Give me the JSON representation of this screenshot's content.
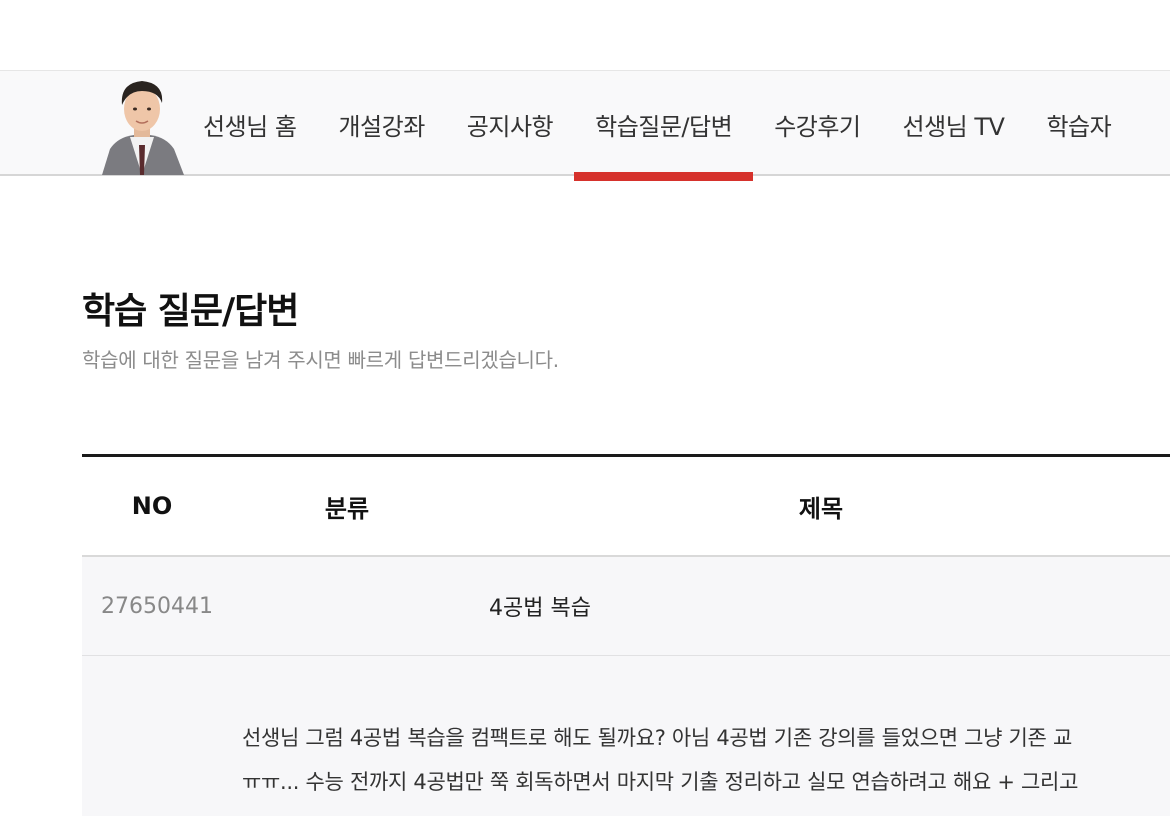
{
  "nav": {
    "tabs": [
      {
        "label": "선생님 홈"
      },
      {
        "label": "개설강좌"
      },
      {
        "label": "공지사항"
      },
      {
        "label": "학습질문/답변"
      },
      {
        "label": "수강후기"
      },
      {
        "label": "선생님 TV"
      },
      {
        "label": "학습자"
      }
    ],
    "active_tab": "학습질문/답변",
    "active_color": "#d6322c"
  },
  "page": {
    "title": "학습 질문/답변",
    "description": "학습에 대한 질문을 남겨 주시면 빠르게 답변드리겠습니다."
  },
  "table": {
    "headers": {
      "no": "NO",
      "category": "분류",
      "title": "제목"
    },
    "rows": [
      {
        "no": "27650441",
        "category": "",
        "title": "4공법 복습"
      }
    ]
  },
  "expanded": {
    "lines": [
      "선생님 그럼 4공법 복습을 컴팩트로 해도 될까요? 아님 4공법 기존 강의를 들었으면 그냥 기존 교",
      "ㅠㅠ... 수능 전까지 4공법만 쭉 회독하면서 마지막 기출 정리하고 실모 연습하려고 해요 + 그리고"
    ]
  }
}
